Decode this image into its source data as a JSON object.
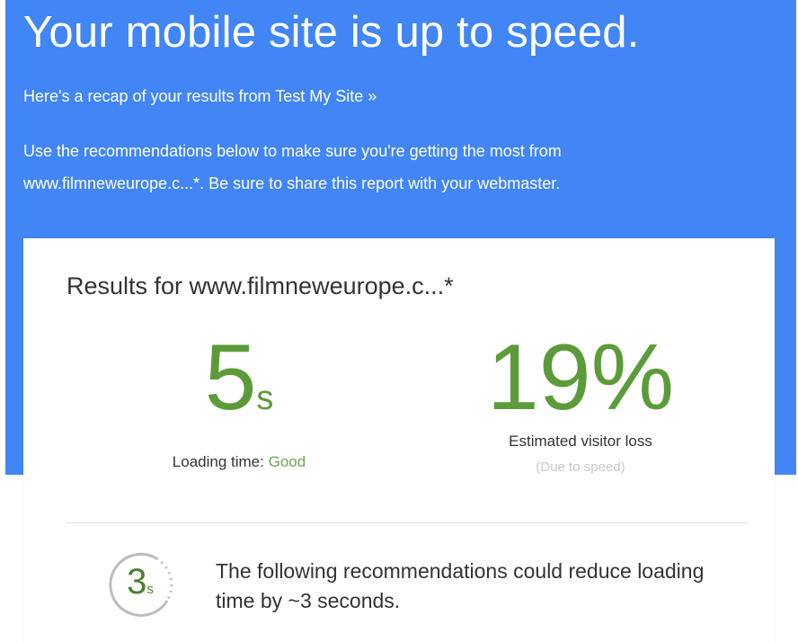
{
  "hero": {
    "title": "Your mobile site is up to speed.",
    "recap_link": "Here's a recap of your results from Test My Site »",
    "intro_line1": "Use the recommendations below to make sure you're getting the most from",
    "intro_line2": "www.filmneweurope.c...*. Be sure to share this report with your webmaster."
  },
  "results": {
    "title": "Results for www.filmneweurope.c...*",
    "loading": {
      "value": "5",
      "unit": "s",
      "label": "Loading time:",
      "rating": "Good"
    },
    "visitor_loss": {
      "value": "19%",
      "label": "Estimated visitor loss",
      "sublabel": "(Due to speed)"
    },
    "recommendation": {
      "savings_value": "3",
      "savings_unit": "s",
      "text": "The following recommendations could reduce loading time by ~3 seconds."
    }
  },
  "colors": {
    "hero_bg": "#4285f4",
    "metric_green": "#5c9b3a",
    "rating_green": "#6aa84f",
    "muted": "#c8c8c8"
  }
}
